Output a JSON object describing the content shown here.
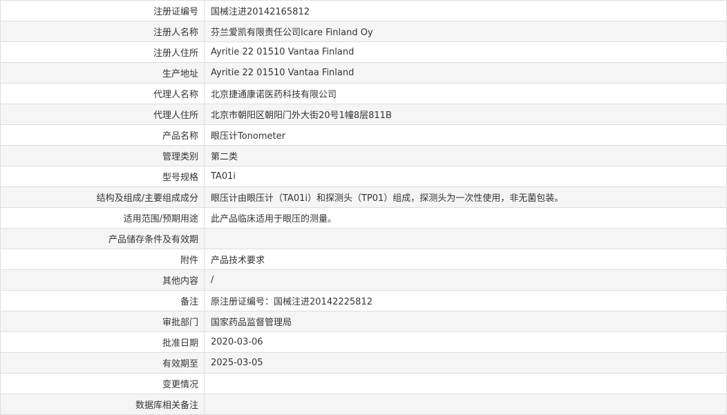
{
  "rows": [
    {
      "label": "注册证编号",
      "value": "国械注进20142165812"
    },
    {
      "label": "注册人名称",
      "value": "芬兰爱凯有限责任公司Icare Finland Oy"
    },
    {
      "label": "注册人住所",
      "value": "Ayritie 22 01510 Vantaa Finland"
    },
    {
      "label": "生产地址",
      "value": "Ayritie 22 01510 Vantaa Finland"
    },
    {
      "label": "代理人名称",
      "value": "北京捷通康诺医药科技有限公司"
    },
    {
      "label": "代理人住所",
      "value": "北京市朝阳区朝阳门外大街20号1幢8层811B"
    },
    {
      "label": "产品名称",
      "value": "眼压计Tonometer"
    },
    {
      "label": "管理类别",
      "value": "第二类"
    },
    {
      "label": "型号规格",
      "value": "TA01i"
    },
    {
      "label": "结构及组成/主要组成成分",
      "value": "眼压计由眼压计（TA01i）和探测头（TP01）组成，探测头为一次性使用，非无菌包装。"
    },
    {
      "label": "适用范围/预期用途",
      "value": "此产品临床适用于眼压的测量。"
    },
    {
      "label": "产品储存条件及有效期",
      "value": ""
    },
    {
      "label": "附件",
      "value": "产品技术要求"
    },
    {
      "label": "其他内容",
      "value": "/"
    },
    {
      "label": "备注",
      "value": "原注册证编号：国械注进20142225812"
    },
    {
      "label": "审批部门",
      "value": "国家药品监督管理局"
    },
    {
      "label": "批准日期",
      "value": "2020-03-06"
    },
    {
      "label": "有效期至",
      "value": "2025-03-05"
    },
    {
      "label": "变更情况",
      "value": ""
    },
    {
      "label": "数据库相关备注",
      "value": ""
    }
  ]
}
